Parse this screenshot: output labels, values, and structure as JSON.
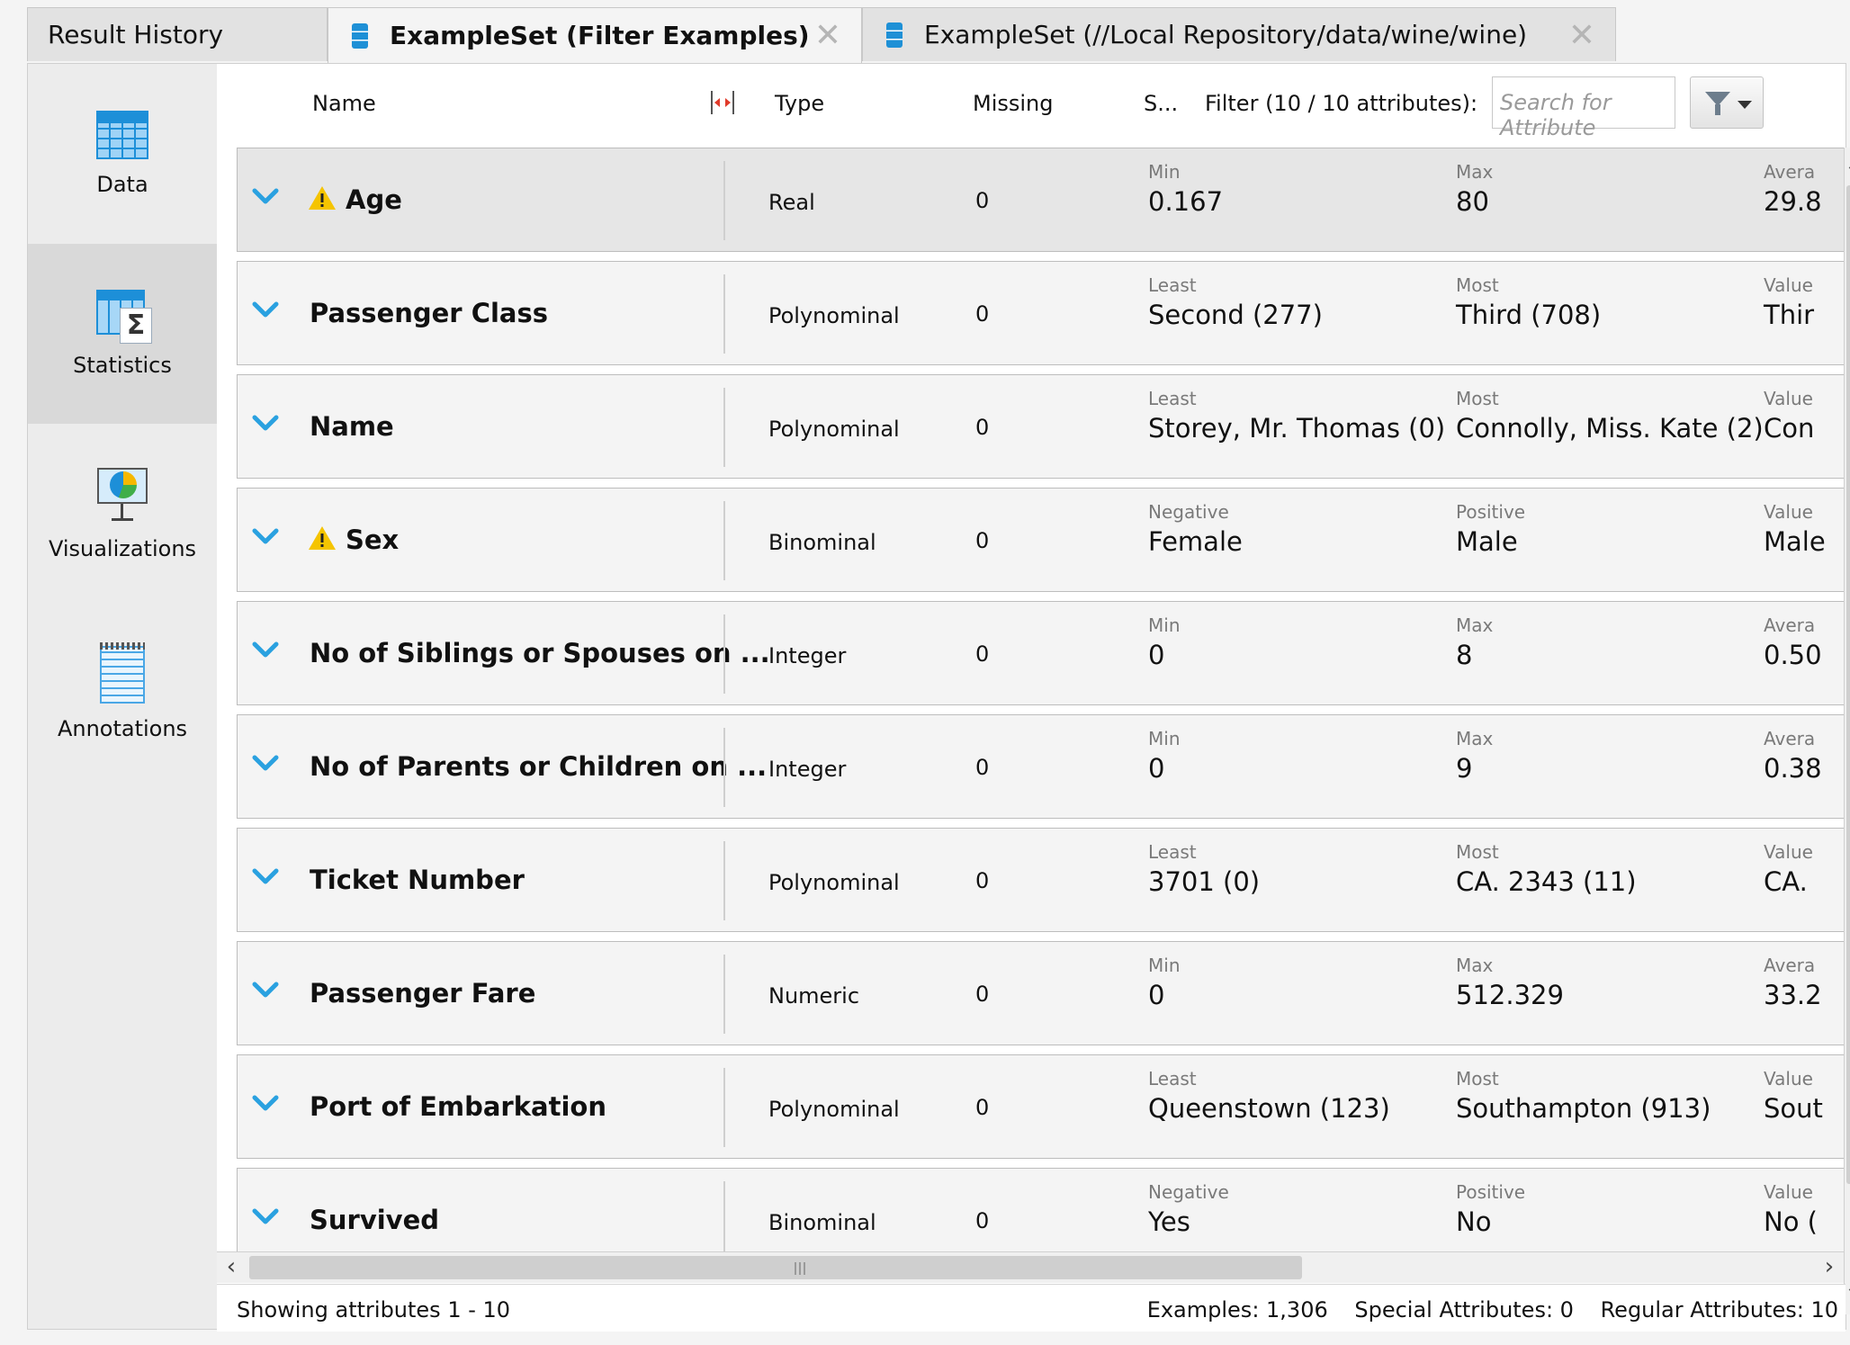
{
  "tabs": [
    {
      "label": "Result History",
      "active": false,
      "icon": null,
      "closable": false
    },
    {
      "label": "ExampleSet (Filter Examples)",
      "active": true,
      "icon": "database-icon",
      "closable": true
    },
    {
      "label": "ExampleSet (//Local Repository/data/wine/wine)",
      "active": false,
      "icon": "database-icon",
      "closable": true
    }
  ],
  "sidebar": {
    "items": [
      {
        "label": "Data",
        "icon": "table-icon",
        "active": false
      },
      {
        "label": "Statistics",
        "icon": "statistics-icon",
        "active": true
      },
      {
        "label": "Visualizations",
        "icon": "visualization-icon",
        "active": false
      },
      {
        "label": "Annotations",
        "icon": "annotations-icon",
        "active": false
      }
    ]
  },
  "header": {
    "name": "Name",
    "type": "Type",
    "missing": "Missing",
    "stats": "S...",
    "filter_label": "Filter (10 / 10 attributes):",
    "search_placeholder": "Search for Attribute"
  },
  "attributes": [
    {
      "name": "Age",
      "warning": true,
      "type": "Real",
      "missing": "0",
      "s1_label": "Min",
      "s1_value": "0.167",
      "s2_label": "Max",
      "s2_value": "80",
      "s3_label": "Avera",
      "s3_value": "29.8"
    },
    {
      "name": "Passenger Class",
      "warning": false,
      "type": "Polynominal",
      "missing": "0",
      "s1_label": "Least",
      "s1_value": "Second (277)",
      "s2_label": "Most",
      "s2_value": "Third (708)",
      "s3_label": "Value",
      "s3_value": "Thir"
    },
    {
      "name": "Name",
      "warning": false,
      "type": "Polynominal",
      "missing": "0",
      "s1_label": "Least",
      "s1_value": "Storey, Mr. Thomas (0)",
      "s2_label": "Most",
      "s2_value": "Connolly, Miss. Kate (2)",
      "s3_label": "Value",
      "s3_value": "Con"
    },
    {
      "name": "Sex",
      "warning": true,
      "type": "Binominal",
      "missing": "0",
      "s1_label": "Negative",
      "s1_value": "Female",
      "s2_label": "Positive",
      "s2_value": "Male",
      "s3_label": "Value",
      "s3_value": "Male"
    },
    {
      "name": "No of Siblings or Spouses on ...",
      "warning": false,
      "type": "Integer",
      "missing": "0",
      "s1_label": "Min",
      "s1_value": "0",
      "s2_label": "Max",
      "s2_value": "8",
      "s3_label": "Avera",
      "s3_value": "0.50"
    },
    {
      "name": "No of Parents or Children on ...",
      "warning": false,
      "type": "Integer",
      "missing": "0",
      "s1_label": "Min",
      "s1_value": "0",
      "s2_label": "Max",
      "s2_value": "9",
      "s3_label": "Avera",
      "s3_value": "0.38"
    },
    {
      "name": "Ticket Number",
      "warning": false,
      "type": "Polynominal",
      "missing": "0",
      "s1_label": "Least",
      "s1_value": "3701 (0)",
      "s2_label": "Most",
      "s2_value": "CA. 2343 (11)",
      "s3_label": "Value",
      "s3_value": "CA."
    },
    {
      "name": "Passenger Fare",
      "warning": false,
      "type": "Numeric",
      "missing": "0",
      "s1_label": "Min",
      "s1_value": "0",
      "s2_label": "Max",
      "s2_value": "512.329",
      "s3_label": "Avera",
      "s3_value": "33.2"
    },
    {
      "name": "Port of Embarkation",
      "warning": false,
      "type": "Polynominal",
      "missing": "0",
      "s1_label": "Least",
      "s1_value": "Queenstown (123)",
      "s2_label": "Most",
      "s2_value": "Southampton (913)",
      "s3_label": "Value",
      "s3_value": "Sout"
    },
    {
      "name": "Survived",
      "warning": false,
      "type": "Binominal",
      "missing": "0",
      "s1_label": "Negative",
      "s1_value": "Yes",
      "s2_label": "Positive",
      "s2_value": "No",
      "s3_label": "Value",
      "s3_value": "No ("
    }
  ],
  "footer": {
    "showing": "Showing attributes 1 - 10",
    "examples": "Examples: 1,306",
    "special": "Special Attributes: 0",
    "regular": "Regular Attributes: 10"
  },
  "colors": {
    "accent": "#1d8fd8",
    "warning": "#f5c400",
    "chevron": "#2aa1e0"
  }
}
